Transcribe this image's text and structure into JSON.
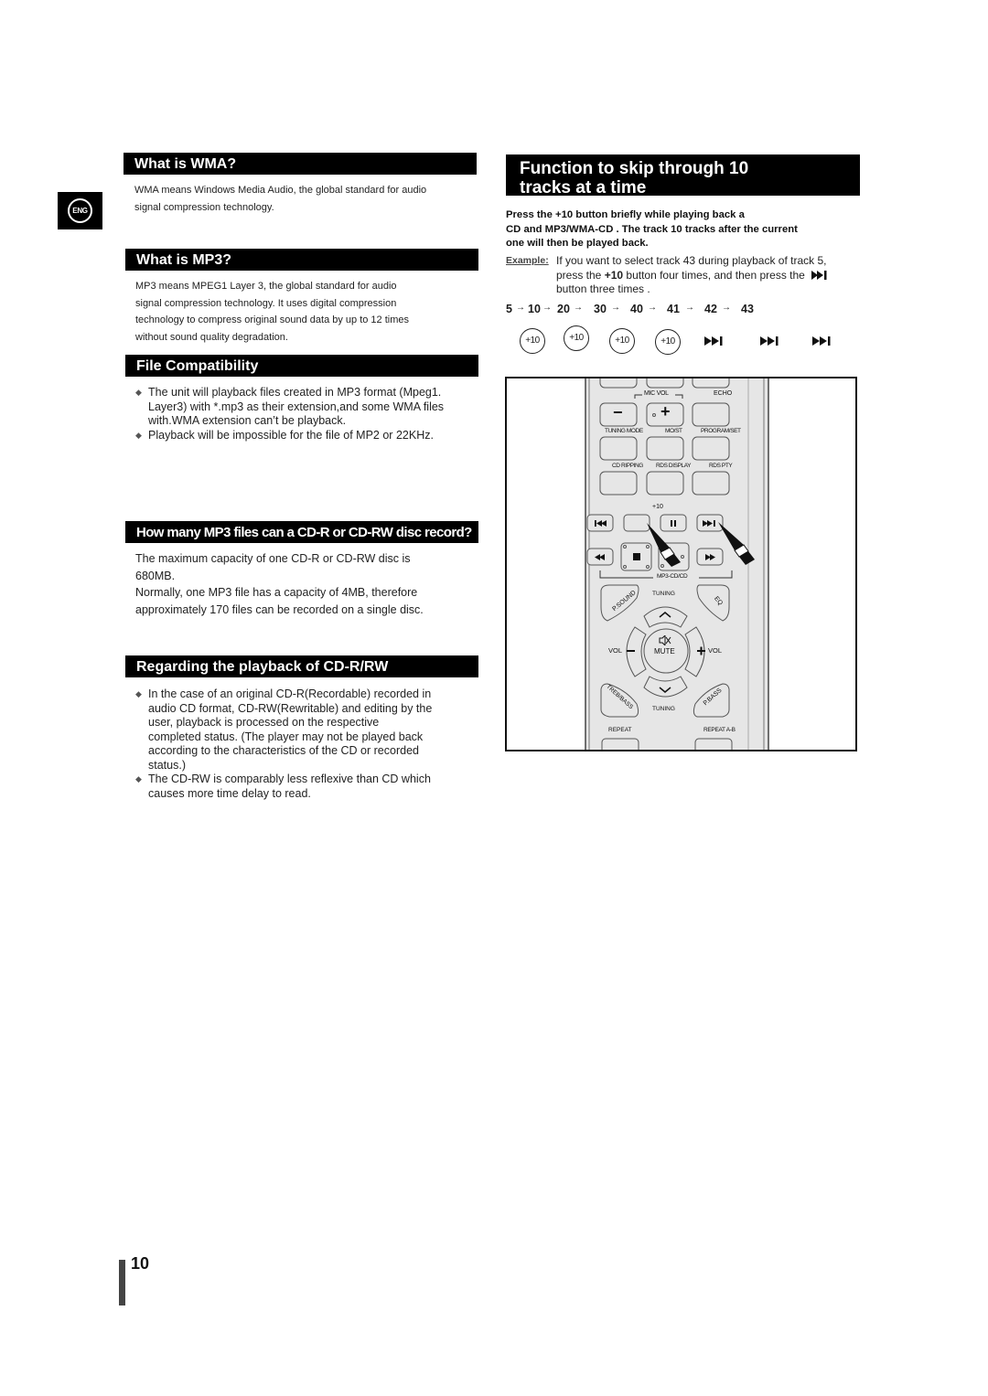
{
  "language_tab": "ENG",
  "left": {
    "wma": {
      "title": "What is WMA?",
      "text": [
        "WMA means Windows Media Audio, the global standard for audio",
        "signal compression technology."
      ]
    },
    "mp3": {
      "title": "What is MP3?",
      "text": [
        "MP3 means MPEG1 Layer 3, the global standard for audio",
        "signal compression technology. It uses digital compression",
        "technology to compress original sound data by up to 12 times",
        "without sound quality degradation."
      ]
    },
    "compat": {
      "title": "File Compatibility",
      "bullets": [
        [
          "The unit will playback files created in MP3 format (Mpeg1.",
          "Layer3) with *.mp3 as their extension,and some WMA files",
          "with.WMA extension can’t be playback."
        ],
        [
          "Playback will be impossible for the file of MP2 or 22KHz."
        ]
      ]
    },
    "howmany": {
      "title": "How many MP3 files can a CD-R or CD-RW disc record?",
      "text": [
        "The maximum capacity of one CD-R or CD-RW disc is",
        "680MB.",
        "Normally, one MP3 file has a capacity of 4MB, therefore",
        "approximately 170 files can be recorded on a single disc."
      ]
    },
    "cdrw": {
      "title": "Regarding the playback of CD-R/RW",
      "bullets": [
        [
          "In the case of an original CD-R(Recordable) recorded in",
          "audio CD format, CD-RW(Rewritable) and editing by the",
          "user, playback is processed on the respective",
          "completed status. (The player may not be played back",
          "according to the characteristics of the CD or recorded",
          "status.)"
        ],
        [
          "The CD-RW is comparably less reflexive than CD which",
          "causes more time delay to read."
        ]
      ]
    }
  },
  "right": {
    "title_lines": [
      "Function to skip through 10",
      "tracks at a time"
    ],
    "instruction": [
      "Press the +10 button briefly while playing back a",
      "CD and MP3/WMA-CD . The track 10 tracks after the current",
      "one will then be played back."
    ],
    "example": {
      "label": "Example:",
      "line1": "If you want to select track 43 during playback of track 5,",
      "line2_pre": "press the ",
      "line2_bold": "+10",
      "line2_post": " button four times, and then press the",
      "line3": "button three times ."
    },
    "sequence": [
      "5",
      "10",
      "20",
      "30",
      "40",
      "41",
      "42",
      "43"
    ],
    "arrow": "→",
    "plus10_label": "+10",
    "plus10_count": 4,
    "skip_count": 3,
    "remote": {
      "mic_vol": "MIC VOL",
      "echo": "ECHO",
      "minus": "−",
      "plus": "+",
      "row2": [
        "TUNING MODE",
        "MO/ST",
        "PROGRAM/SET"
      ],
      "row3": [
        "CD RIPPING",
        "RDS DISPLAY",
        "RDS PTY"
      ],
      "plus10": "+10",
      "mp3cd": "MP3-CD/CD",
      "psound": "P.SOUND",
      "eq": "EQ",
      "tuning": "TUNING",
      "vol": "VOL",
      "mute": "MUTE",
      "treb": "TREB/BASS",
      "pbass": "P.BASS",
      "repeat": "REPEAT",
      "repeat_ab": "REPEAT A-B"
    }
  },
  "page_number": "10"
}
